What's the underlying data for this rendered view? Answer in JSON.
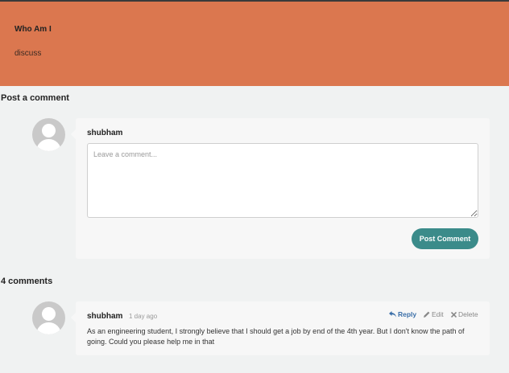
{
  "header": {
    "title": "Who Am I",
    "subtitle": "discuss",
    "background": "#db774f"
  },
  "post_section": {
    "heading": "Post a comment",
    "username": "shubham",
    "textarea": {
      "placeholder": "Leave a comment...",
      "value": ""
    },
    "submit_label": "Post Comment",
    "accent": "#3b8b8a"
  },
  "comments_section": {
    "heading": "4 comments",
    "comments": [
      {
        "author": "shubham",
        "time": "1 day ago",
        "text": "As an engineering student, I strongly believe that I should get a job by end of the 4th year. But I don't know the path of going. Could you please help me in that",
        "actions": {
          "reply": "Reply",
          "edit": "Edit",
          "delete": "Delete"
        }
      }
    ]
  }
}
